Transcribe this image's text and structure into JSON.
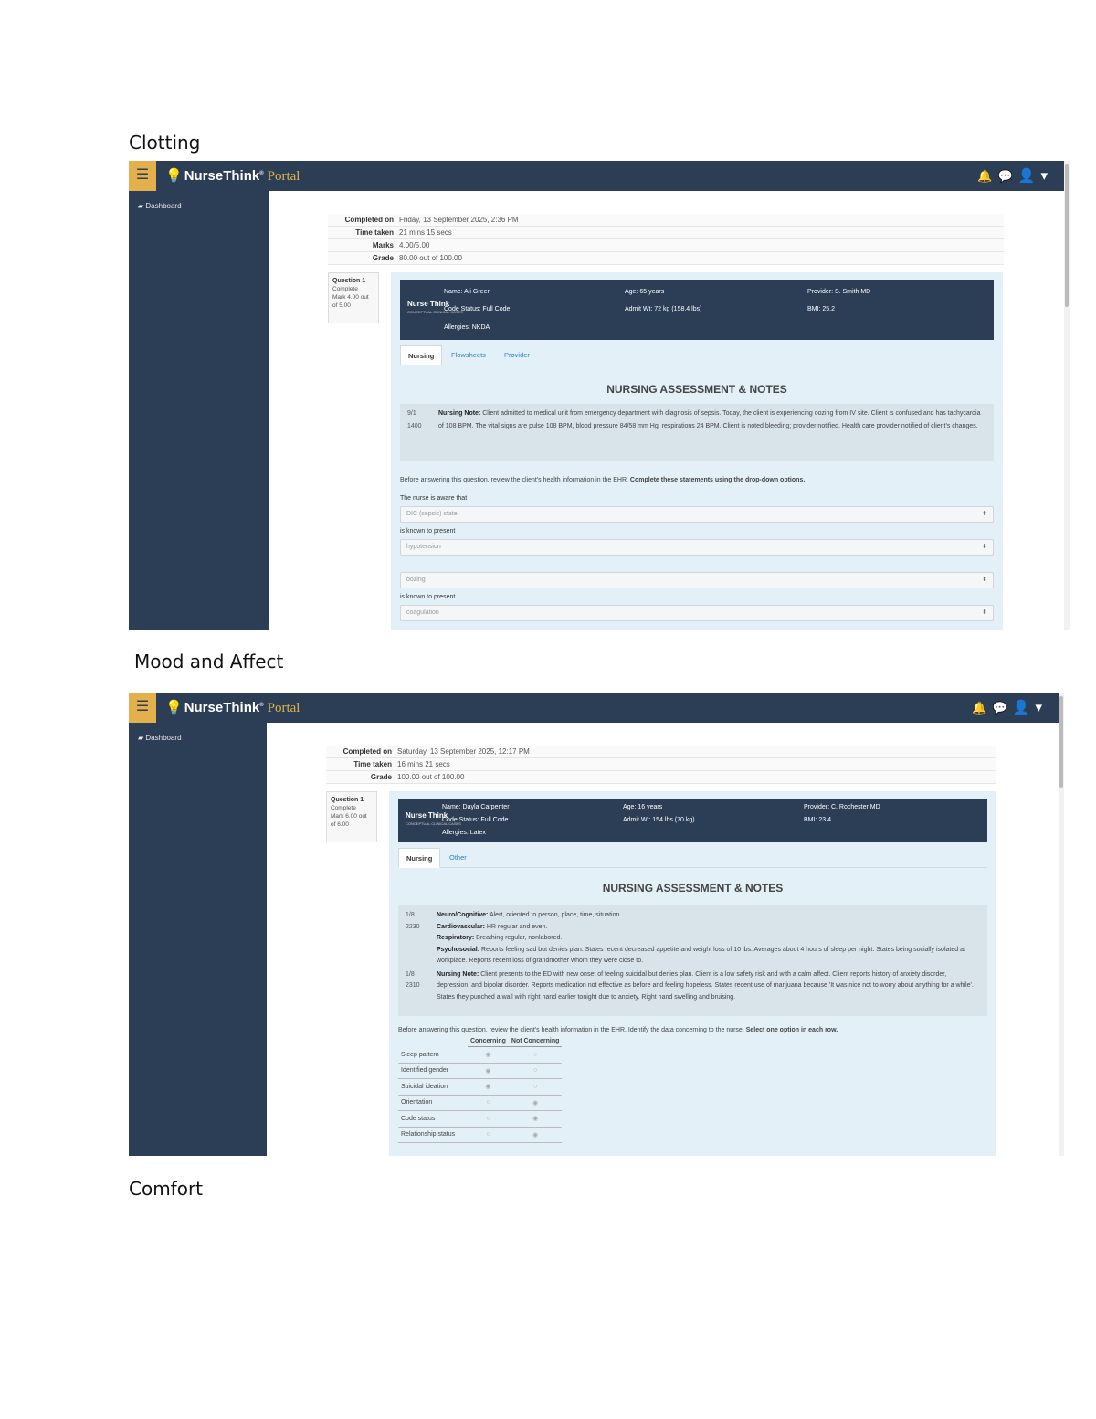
{
  "headings": [
    "Clotting",
    "Mood and Affect",
    "Comfort"
  ],
  "shot1": {
    "brand": {
      "name": "NurseThink",
      "reg": "®",
      "suffix": "Portal"
    },
    "menu_icon": "hamburger-icon",
    "nav_icons": [
      "bell-icon",
      "chat-icon",
      "user-icon"
    ],
    "sidebar": {
      "link": "Dashboard",
      "icon": "dashboard-icon"
    },
    "summary": [
      {
        "key": "Completed on",
        "value": "Friday, 13 September 2025, 2:36 PM"
      },
      {
        "key": "Time taken",
        "value": "21 mins 15 secs"
      },
      {
        "key": "Marks",
        "value": "4.00/5.00"
      },
      {
        "key": "Grade",
        "value": "80.00 out of 100.00"
      }
    ],
    "question_info": {
      "number": "1",
      "status": "Complete",
      "mark": "Mark 4.00 out of 5.00"
    },
    "ehr": {
      "logo": "Nurse Think",
      "logo_sub": "CONCEPTUAL CLINICAL CASES",
      "cells": [
        "Name: Ali Green",
        "Age: 65 years",
        "Provider: S. Smith MD",
        "Code Status: Full Code",
        "Admit Wt: 72 kg (158.4 lbs)",
        "BMI: 25.2",
        "Allergies: NKDA"
      ]
    },
    "tabs": [
      "Nursing",
      "Flowsheets",
      "Provider"
    ],
    "section_title": "NURSING ASSESSMENT & NOTES",
    "notes": [
      {
        "time": [
          "9/1",
          "1400"
        ],
        "label": "Nursing Note:",
        "text": " Client admitted to medical unit from emergency department with diagnosis of sepsis. Today, the client is experiencing oozing from IV site. Client is confused and has tachycardia of 108 BPM. The vital signs are pulse 108 BPM, blood pressure 84/58 mm Hg, respirations 24 BPM. Client is noted bleeding; provider notified. Health care provider notified of client's changes."
      }
    ],
    "instruction": "Before answering this question, review the client's health information in the EHR. ",
    "instruction_bold": "Complete these statements using the drop-down options.",
    "fields": [
      {
        "label": "The nurse is aware that",
        "value": "DIC (sepsis) state"
      },
      {
        "label": "is known to present",
        "value": "hypotension"
      },
      {
        "label": "",
        "value": "oozing"
      },
      {
        "label": "is known to present",
        "value": "coagulation"
      }
    ]
  },
  "shot2": {
    "brand": {
      "name": "NurseThink",
      "reg": "®",
      "suffix": "Portal"
    },
    "menu_icon": "hamburger-icon",
    "nav_icons": [
      "bell-icon",
      "chat-icon",
      "user-icon"
    ],
    "sidebar": {
      "link": "Dashboard",
      "icon": "dashboard-icon"
    },
    "summary": [
      {
        "key": "Completed on",
        "value": "Saturday, 13 September 2025, 12:17 PM"
      },
      {
        "key": "Time taken",
        "value": "16 mins 21 secs"
      },
      {
        "key": "Grade",
        "value": "100.00 out of 100.00"
      }
    ],
    "question_info": {
      "number": "1",
      "status": "Complete",
      "mark": "Mark 6.00 out of 6.00"
    },
    "ehr": {
      "logo": "Nurse Think",
      "logo_sub": "CONCEPTUAL CLINICAL CASES",
      "cells": [
        "Name: Dayla Carpenter",
        "Age: 16 years",
        "Provider: C. Rochester MD",
        "Code Status: Full Code",
        "Admit Wt: 154 lbs (70 kg)",
        "BMI: 23.4",
        "Allergies: Latex"
      ]
    },
    "tabs": [
      "Nursing",
      "Other"
    ],
    "section_title": "NURSING ASSESSMENT & NOTES",
    "notes": [
      {
        "time": [
          "1/8",
          "2230"
        ],
        "label": "Neuro/Cognitive:",
        "text": " Alert, oriented to person, place, time, situation."
      },
      {
        "time": [
          "",
          ""
        ],
        "label": "Cardiovascular:",
        "text": " HR regular and even."
      },
      {
        "time": [
          "",
          ""
        ],
        "label": "Respiratory:",
        "text": " Breathing regular, nonlabored."
      },
      {
        "time": [
          "",
          ""
        ],
        "label": "Psychosocial:",
        "text": " Reports feeling sad but denies plan. States recent decreased appetite and weight loss of 10 lbs. Averages about 4 hours of sleep per night. States being socially isolated at workplace. Reports recent loss of grandmother whom they were close to."
      },
      {
        "time": [
          "1/8",
          "2310"
        ],
        "label": "Nursing Note:",
        "text": " Client presents to the ED with new onset of feeling suicidal but denies plan. Client is a low safety risk and with a calm affect. Client reports history of anxiety disorder, depression, and bipolar disorder. Reports medication not effective as before and feeling hopeless. States recent use of marijuana because 'It was nice not to worry about anything for a while'. States they punched a wall with right hand earlier tonight due to anxiety. Right hand swelling and bruising."
      }
    ],
    "instruction": "Before answering this question, review the client's health information in the EHR. Identify the data concerning to the nurse. ",
    "instruction_bold": "Select one option in each row.",
    "matrix": {
      "columns": [
        "Concerning",
        "Not Concerning"
      ],
      "rows": [
        {
          "label": "Sleep pattern",
          "selected": "Concerning"
        },
        {
          "label": "Identified gender",
          "selected": "Concerning"
        },
        {
          "label": "Suicidal ideation",
          "selected": "Concerning"
        },
        {
          "label": "Orientation",
          "selected": "Not Concerning"
        },
        {
          "label": "Code status",
          "selected": "Not Concerning"
        },
        {
          "label": "Relationship status",
          "selected": "Not Concerning"
        }
      ]
    }
  }
}
